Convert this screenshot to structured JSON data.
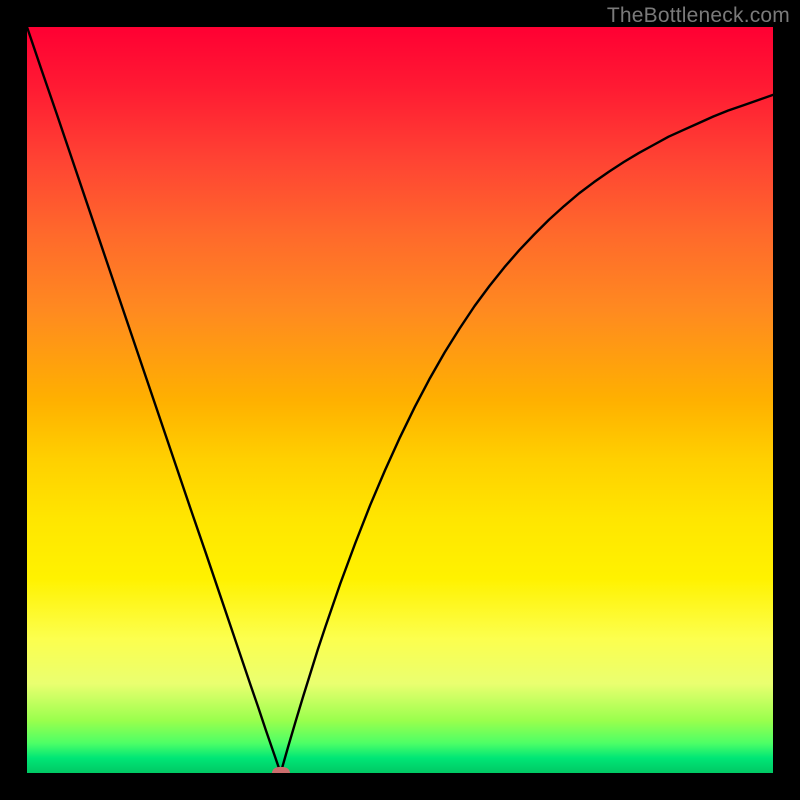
{
  "watermark": "TheBottleneck.com",
  "colors": {
    "frame": "#000000",
    "marker": "#cc6d6d",
    "curve": "#000000",
    "gradient_top": "#ff0033",
    "gradient_bottom": "#00c864"
  },
  "chart_data": {
    "type": "line",
    "title": "",
    "xlabel": "",
    "ylabel": "",
    "xlim": [
      0,
      100
    ],
    "ylim": [
      0,
      100
    ],
    "x": [
      0,
      2,
      4,
      6,
      8,
      10,
      12,
      14,
      16,
      18,
      20,
      22,
      24,
      26,
      28,
      30,
      31,
      32,
      33,
      34,
      35,
      36,
      37,
      38,
      39,
      40,
      42,
      44,
      46,
      48,
      50,
      52,
      54,
      56,
      58,
      60,
      62,
      64,
      66,
      68,
      70,
      72,
      74,
      76,
      78,
      80,
      82,
      84,
      86,
      88,
      90,
      92,
      94,
      96,
      98,
      100
    ],
    "values": [
      100,
      94.1,
      88.3,
      82.4,
      76.5,
      70.6,
      64.7,
      58.8,
      52.9,
      47.0,
      41.1,
      35.2,
      29.4,
      23.5,
      17.6,
      11.7,
      8.8,
      5.8,
      2.9,
      0.0,
      3.5,
      6.9,
      10.2,
      13.4,
      16.6,
      19.6,
      25.4,
      30.8,
      35.9,
      40.6,
      45.0,
      49.1,
      52.9,
      56.4,
      59.6,
      62.6,
      65.3,
      67.8,
      70.1,
      72.2,
      74.2,
      76.0,
      77.7,
      79.2,
      80.6,
      81.9,
      83.1,
      84.2,
      85.3,
      86.2,
      87.1,
      88.0,
      88.8,
      89.5,
      90.2,
      90.9
    ],
    "marker": {
      "x": 34,
      "y": 0
    },
    "annotations": []
  }
}
